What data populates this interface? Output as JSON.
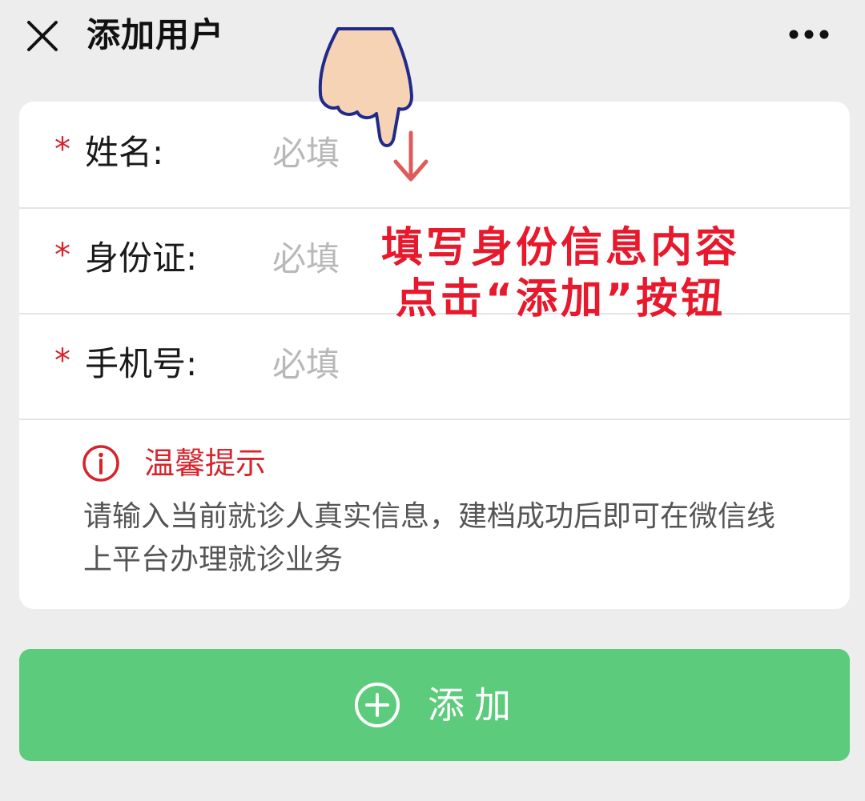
{
  "header": {
    "title": "添加用户",
    "close_icon": "close-icon",
    "more_icon": "more-icon"
  },
  "form": {
    "fields": [
      {
        "required_mark": "*",
        "label": "姓名:",
        "placeholder": "必填",
        "value": ""
      },
      {
        "required_mark": "*",
        "label": "身份证:",
        "placeholder": "必填",
        "value": ""
      },
      {
        "required_mark": "*",
        "label": "手机号:",
        "placeholder": "必填",
        "value": ""
      }
    ]
  },
  "tip": {
    "icon": "info-icon",
    "title": "温馨提示",
    "text": "请输入当前就诊人真实信息，建档成功后即可在微信线上平台办理就诊业务"
  },
  "add_button": {
    "icon": "plus-circle-icon",
    "label": "添加"
  },
  "overlay": {
    "hand_icon": "pointing-hand-icon",
    "arrow_icon": "arrow-down-icon",
    "annotation_line1": "填写身份信息内容",
    "annotation_line2": "点击“添加”按钮"
  },
  "colors": {
    "background": "#ededed",
    "required": "#d8232a",
    "button": "#5ccb7b",
    "annotation": "#e8192c"
  }
}
